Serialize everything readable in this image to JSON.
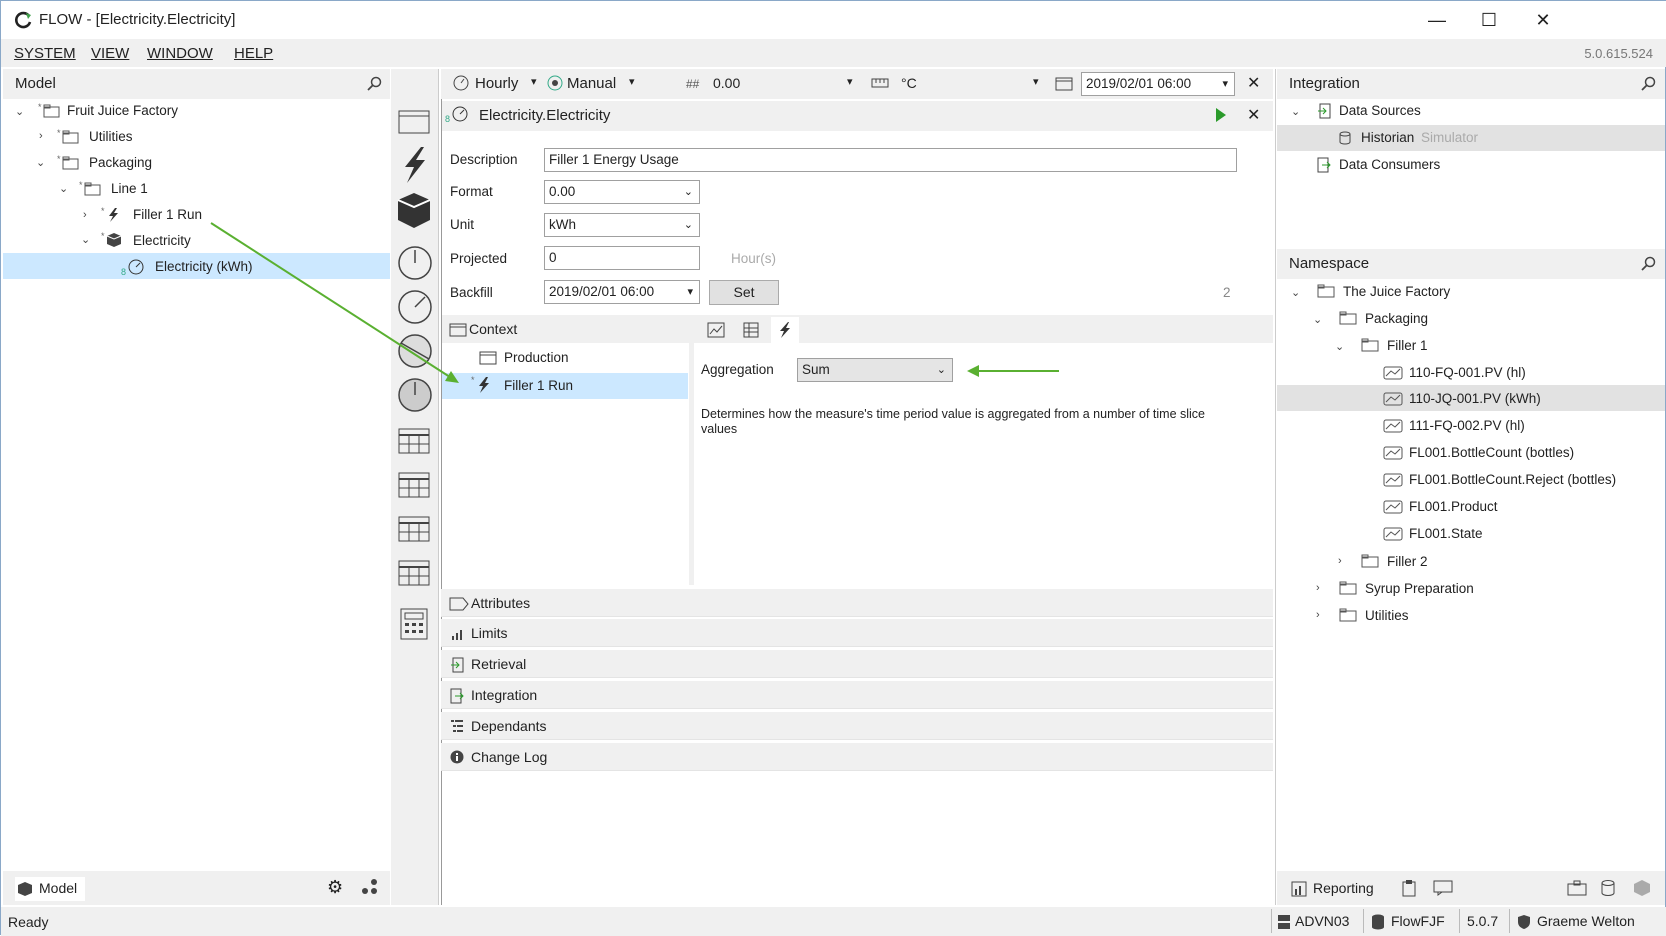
{
  "window": {
    "title": "FLOW - [Electricity.Electricity]",
    "minimize": "—",
    "maximize": "☐",
    "close": "✕"
  },
  "menu": {
    "items": [
      "SYSTEM",
      "VIEW",
      "WINDOW",
      "HELP"
    ],
    "version": "5.0.615.524"
  },
  "model": {
    "header": "Model",
    "tree": [
      "Fruit Juice Factory",
      "Utilities",
      "Packaging",
      "Line 1",
      "Filler 1 Run",
      "Electricity",
      "Electricity (kWh)"
    ],
    "footer_label": "Model"
  },
  "toolbar": {
    "interval": "Hourly",
    "mode": "Manual",
    "format_icon": "##",
    "format": "0.00",
    "unit": "°C",
    "date": "2019/02/01 06:00"
  },
  "editor": {
    "title": "Electricity.Electricity",
    "description_label": "Description",
    "description": "Filler 1 Energy Usage",
    "format_label": "Format",
    "format": "0.00",
    "unit_label": "Unit",
    "unit": "kWh",
    "projected_label": "Projected",
    "projected": "0",
    "projected_unit": "Hour(s)",
    "backfill_label": "Backfill",
    "backfill": "2019/02/01 06:00",
    "set_label": "Set",
    "backfill_count": "2",
    "context_label": "Context",
    "context_items": [
      "Production",
      "Filler 1 Run"
    ],
    "aggregation_label": "Aggregation",
    "aggregation": "Sum",
    "aggregation_help": "Determines how the measure's time period value is aggregated from a number of time slice values",
    "sections": [
      "Attributes",
      "Limits",
      "Retrieval",
      "Integration",
      "Dependants",
      "Change Log"
    ]
  },
  "integration": {
    "header": "Integration",
    "data_sources": "Data Sources",
    "historian": "Historian",
    "historian_type": "Simulator",
    "data_consumers": "Data Consumers"
  },
  "namespace": {
    "header": "Namespace",
    "tree": [
      "The Juice Factory",
      "Packaging",
      "Filler 1",
      "110-FQ-001.PV (hl)",
      "110-JQ-001.PV (kWh)",
      "111-FQ-002.PV (hl)",
      "FL001.BottleCount (bottles)",
      "FL001.BottleCount.Reject (bottles)",
      "FL001.Product",
      "FL001.State",
      "Filler 2",
      "Syrup Preparation",
      "Utilities"
    ]
  },
  "right_footer": {
    "reporting": "Reporting"
  },
  "status": {
    "text": "Ready",
    "server": "ADVN03",
    "db": "FlowFJF",
    "version": "5.0.7",
    "user": "Graeme Welton"
  },
  "colors": {
    "accent": "#cce8ff",
    "arrow": "#5ab031",
    "logo": "#3ea049"
  }
}
